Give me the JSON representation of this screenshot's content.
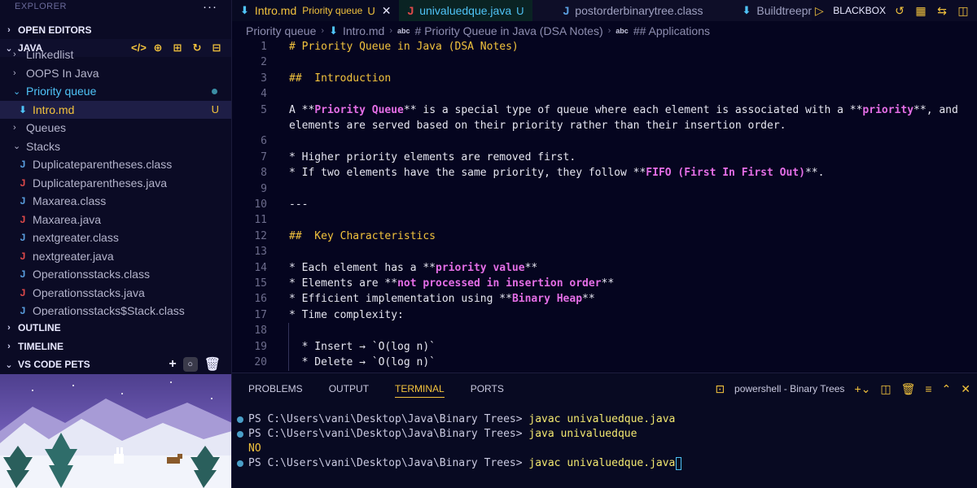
{
  "sidebar": {
    "title": "EXPLORER",
    "open_editors": "OPEN EDITORS",
    "java_section": "JAVA",
    "tree": [
      {
        "type": "folder",
        "label": "Linkedlist"
      },
      {
        "type": "folder",
        "label": "OOPS In Java"
      },
      {
        "type": "folder-open",
        "label": "Priority queue"
      },
      {
        "type": "file-md",
        "label": "Intro.md",
        "badge": "U"
      },
      {
        "type": "folder",
        "label": "Queues"
      },
      {
        "type": "folder-open",
        "label": "Stacks"
      },
      {
        "type": "file-class",
        "label": "Duplicateparentheses.class"
      },
      {
        "type": "file-java",
        "label": "Duplicateparentheses.java"
      },
      {
        "type": "file-class",
        "label": "Maxarea.class"
      },
      {
        "type": "file-java",
        "label": "Maxarea.java"
      },
      {
        "type": "file-class",
        "label": "nextgreater.class"
      },
      {
        "type": "file-java",
        "label": "nextgreater.java"
      },
      {
        "type": "file-class",
        "label": "Operationsstacks.class"
      },
      {
        "type": "file-java",
        "label": "Operationsstacks.java"
      },
      {
        "type": "file-class",
        "label": "Operationsstacks$Stack.class"
      }
    ],
    "outline": "OUTLINE",
    "timeline": "TIMELINE",
    "pets": "VS CODE PETS"
  },
  "tabs": [
    {
      "label": "Intro.md",
      "sub": "Priority queue",
      "badge": "U",
      "icon": "markdown-icon"
    },
    {
      "label": "univaluedque.java",
      "badge": "U",
      "icon": "java-icon"
    },
    {
      "label": "postorderbinarytree.class",
      "icon": "class-icon"
    },
    {
      "label": "Buildtreepreor",
      "icon": "markdown-icon"
    }
  ],
  "editor_actions": {
    "blackbox": "BLACKBOX"
  },
  "breadcrumb": {
    "folder": "Priority queue",
    "file": "Intro.md",
    "h1": "# Priority Queue in Java (DSA Notes)",
    "h2": "## Applications",
    "abc": "abc"
  },
  "code_lines": [
    {
      "n": "1",
      "parts": [
        {
          "c": "hd",
          "t": "# Priority Queue in Java (DSA Notes)"
        }
      ]
    },
    {
      "n": "2",
      "parts": []
    },
    {
      "n": "3",
      "parts": [
        {
          "c": "hd",
          "t": "##  Introduction"
        }
      ]
    },
    {
      "n": "4",
      "parts": []
    },
    {
      "n": "5",
      "parts": [
        {
          "c": "",
          "t": "A **"
        },
        {
          "c": "kw",
          "t": "Priority Queue"
        },
        {
          "c": "",
          "t": "** is a special type of queue where each element is associated with a **"
        },
        {
          "c": "kw",
          "t": "priority"
        },
        {
          "c": "",
          "t": "**, and"
        }
      ]
    },
    {
      "n": "",
      "parts": [
        {
          "c": "",
          "t": "elements are served based on their priority rather than their insertion order."
        }
      ]
    },
    {
      "n": "6",
      "parts": []
    },
    {
      "n": "7",
      "parts": [
        {
          "c": "",
          "t": "* Higher priority elements are removed first."
        }
      ]
    },
    {
      "n": "8",
      "parts": [
        {
          "c": "",
          "t": "* If two elements have the same priority, they follow **"
        },
        {
          "c": "kw",
          "t": "FIFO (First In First Out)"
        },
        {
          "c": "",
          "t": "**."
        }
      ]
    },
    {
      "n": "9",
      "parts": []
    },
    {
      "n": "10",
      "parts": [
        {
          "c": "",
          "t": "---"
        }
      ]
    },
    {
      "n": "11",
      "parts": []
    },
    {
      "n": "12",
      "parts": [
        {
          "c": "hd",
          "t": "##  Key Characteristics"
        }
      ]
    },
    {
      "n": "13",
      "parts": []
    },
    {
      "n": "14",
      "parts": [
        {
          "c": "",
          "t": "* Each element has a **"
        },
        {
          "c": "kw",
          "t": "priority value"
        },
        {
          "c": "",
          "t": "**"
        }
      ]
    },
    {
      "n": "15",
      "parts": [
        {
          "c": "",
          "t": "* Elements are **"
        },
        {
          "c": "kw",
          "t": "not processed in insertion order"
        },
        {
          "c": "",
          "t": "**"
        }
      ]
    },
    {
      "n": "16",
      "parts": [
        {
          "c": "",
          "t": "* Efficient implementation using **"
        },
        {
          "c": "kw",
          "t": "Binary Heap"
        },
        {
          "c": "",
          "t": "**"
        }
      ]
    },
    {
      "n": "17",
      "parts": [
        {
          "c": "",
          "t": "* Time complexity:"
        }
      ]
    },
    {
      "n": "18",
      "parts": []
    },
    {
      "n": "19",
      "parts": [
        {
          "c": "",
          "t": "  * Insert → `O(log n)`"
        }
      ]
    },
    {
      "n": "20",
      "parts": [
        {
          "c": "",
          "t": "  * Delete → `O(log n)`"
        }
      ]
    }
  ],
  "panel": {
    "tabs": [
      "PROBLEMS",
      "OUTPUT",
      "TERMINAL",
      "PORTS"
    ],
    "active_tab": "TERMINAL",
    "terminal_label": "powershell - Binary Trees",
    "lines": [
      {
        "dot": true,
        "prompt": "PS C:\\Users\\vani\\Desktop\\Java\\Binary Trees> ",
        "cmd": "javac univaluedque.java"
      },
      {
        "dot": true,
        "prompt": "PS C:\\Users\\vani\\Desktop\\Java\\Binary Trees> ",
        "cmd": "java univaluedque"
      },
      {
        "dot": false,
        "output": "NO"
      },
      {
        "dot": true,
        "prompt": "PS C:\\Users\\vani\\Desktop\\Java\\Binary Trees> ",
        "cmd": "javac univaluedque.java",
        "cursor": true
      }
    ]
  }
}
